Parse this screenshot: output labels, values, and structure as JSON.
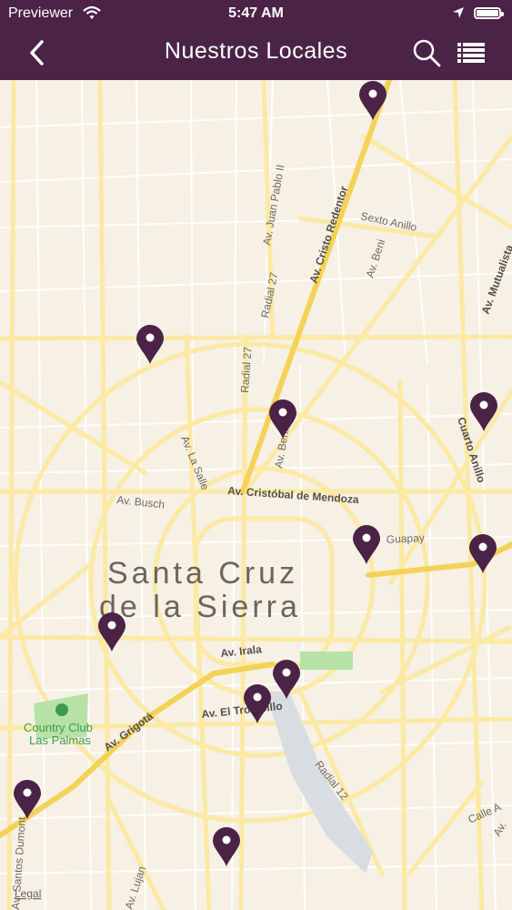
{
  "status_bar": {
    "carrier": "Previewer",
    "time": "5:47 AM",
    "battery_level": 1.0
  },
  "nav": {
    "title": "Nuestros Locales",
    "back_icon": "chevron-left-icon",
    "search_icon": "search-icon",
    "list_icon": "list-icon"
  },
  "map": {
    "city_name_line1": "Santa Cruz",
    "city_name_line2": "de la Sierra",
    "park_name_line1": "Country Club",
    "park_name_line2": "Las Palmas",
    "legal": "Legal",
    "streets": {
      "juan_pablo": "Av. Juan Pablo II",
      "cristo_redentor": "Av. Cristo Redentor",
      "sexto_anillo": "Sexto Anillo",
      "beni_top": "Av. Beni",
      "radial_27a": "Radial 27",
      "radial_27b": "Radial 27",
      "mutualista": "Av. Mutualista",
      "beni_mid": "Av. Beni",
      "cuarto_anillo": "Cuarto Anillo",
      "la_salle": "Av. La Salle",
      "cristobal": "Av. Cristóbal de Mendoza",
      "busch": "Av. Busch",
      "guapay": "Guapay",
      "irala": "Av. Irala",
      "el_trompillo": "Av. El Trompillo",
      "grigota": "Av. Grigotá",
      "radial_12": "Radial 12",
      "calle_a": "Calle A",
      "lujan": "Av. Lujan",
      "santos": "Av. Santos Dumont",
      "right_av": "Av."
    },
    "colors": {
      "land": "#f6f1e4",
      "road": "#fbe9a4",
      "road_major": "#f4d257",
      "minor_road": "#ffffff",
      "pin": "#4a2347",
      "park": "#b6e2a6",
      "water": "#d7dde1"
    },
    "pins": [
      {
        "name": "store-pin-1"
      },
      {
        "name": "store-pin-2"
      },
      {
        "name": "store-pin-3"
      },
      {
        "name": "store-pin-4"
      },
      {
        "name": "store-pin-5"
      },
      {
        "name": "store-pin-6"
      },
      {
        "name": "store-pin-7"
      },
      {
        "name": "store-pin-8"
      },
      {
        "name": "store-pin-9"
      },
      {
        "name": "store-pin-10"
      },
      {
        "name": "store-pin-11"
      }
    ]
  }
}
